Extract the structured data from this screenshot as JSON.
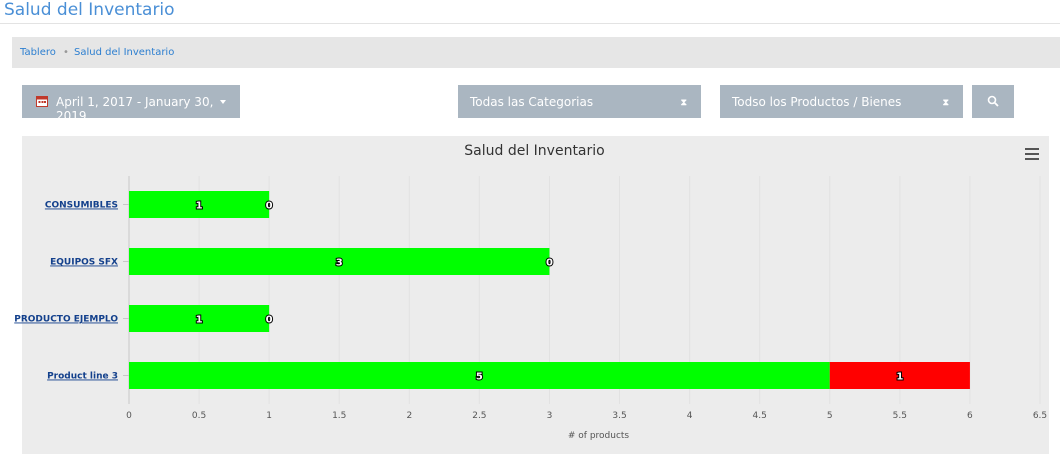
{
  "page": {
    "title": "Salud del Inventario"
  },
  "breadcrumb": {
    "items": [
      "Tablero",
      "Salud del Inventario"
    ],
    "separator": "•"
  },
  "filters": {
    "date_range": "April 1, 2017 - January 30, 2019",
    "category": "Todas las Categorias",
    "product": "Todso los Productos / Bienes",
    "selector_icon": "hourglass-icon",
    "search_icon": "search-icon"
  },
  "chart_menu_icon": "hamburger-menu-icon",
  "colors": {
    "healthy": "#00ff00",
    "unhealthy": "#ff0000",
    "accent": "#4a8fd6",
    "control": "#aab6c1"
  },
  "chart_data": {
    "type": "bar",
    "orientation": "horizontal",
    "stacked": true,
    "title": "Salud del Inventario",
    "xlabel": "# of products",
    "ylabel": "",
    "xlim": [
      0,
      6.5
    ],
    "xticks": [
      "0",
      "0.5",
      "1",
      "1.5",
      "2",
      "2.5",
      "3",
      "3.5",
      "4",
      "4.5",
      "5",
      "5.5",
      "6",
      "6.5"
    ],
    "categories": [
      "CONSUMIBLES",
      "EQUIPOS SFX",
      "PRODUCTO EJEMPLO",
      "Product line 3"
    ],
    "series": [
      {
        "values": [
          1,
          3,
          1,
          5
        ],
        "color": "#00ff00"
      },
      {
        "values": [
          0,
          0,
          0,
          1
        ],
        "color": "#ff0000"
      }
    ],
    "grid": true,
    "legend": "none"
  }
}
